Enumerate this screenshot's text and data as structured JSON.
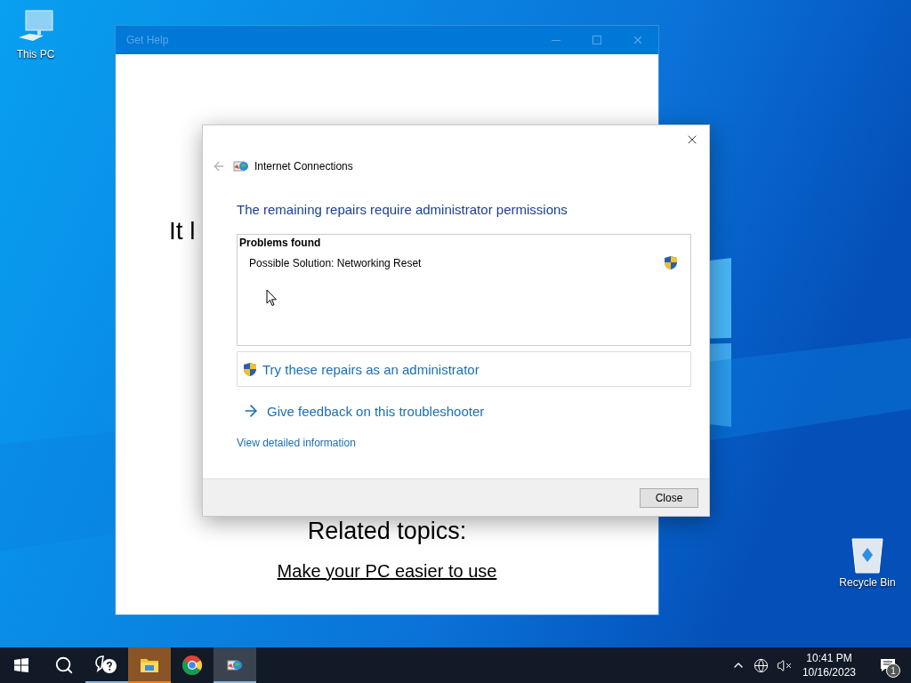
{
  "desktop_icons": [
    {
      "label": "This PC",
      "kind": "computer"
    },
    {
      "label": "Recycle Bin",
      "kind": "recycle-bin"
    }
  ],
  "help_window": {
    "title": "Get Help",
    "partial_heading": "It l",
    "related_heading": "Related topics:",
    "related_links": [
      "Make your PC easier to use"
    ]
  },
  "dialog": {
    "back_disabled": true,
    "title": "Internet Connections",
    "heading": "The remaining repairs require administrator permissions",
    "problems": {
      "title": "Problems found",
      "items": [
        {
          "text": "Possible Solution: Networking Reset",
          "requires_admin": true
        }
      ]
    },
    "admin_action": "Try these repairs as an administrator",
    "feedback_link": "Give feedback on this troubleshooter",
    "details_link": "View detailed information",
    "buttons": [
      "Close"
    ]
  },
  "taskbar": {
    "apps": [
      {
        "kind": "start",
        "open": false,
        "focused": false,
        "flashing": false
      },
      {
        "kind": "search",
        "open": false,
        "focused": false,
        "flashing": false
      },
      {
        "kind": "help",
        "open": true,
        "focused": false,
        "flashing": false
      },
      {
        "kind": "explorer",
        "open": true,
        "focused": false,
        "flashing": true
      },
      {
        "kind": "browser",
        "open": false,
        "focused": false,
        "flashing": false
      },
      {
        "kind": "troubleshooter",
        "open": true,
        "focused": true,
        "flashing": false
      }
    ],
    "clock": {
      "time": "10:41 PM",
      "date": "10/16/2023"
    },
    "notification_count": "1"
  }
}
